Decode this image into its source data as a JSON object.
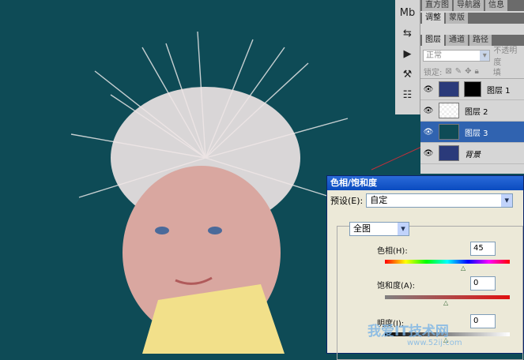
{
  "panel_tabs_top": [
    "直方图",
    "导航器",
    "信息"
  ],
  "panel_tabs_adjust": [
    "调整",
    "蒙版"
  ],
  "panel_tabs_layers": [
    "图层",
    "通道",
    "路径"
  ],
  "blend_mode": "正常",
  "opacity_label": "不透明度",
  "lock_label": "锁定:",
  "fill_label": "填",
  "layers": [
    {
      "name": "图层 1",
      "selected": false
    },
    {
      "name": "图层 2",
      "selected": false
    },
    {
      "name": "图层 3",
      "selected": true
    },
    {
      "name": "背景",
      "selected": false
    }
  ],
  "dialog": {
    "title": "色相/饱和度",
    "preset_label": "预设(E):",
    "preset_value": "自定",
    "channel_value": "全图",
    "hue_label": "色相(H):",
    "hue_value": "45",
    "saturation_label": "饱和度(A):",
    "saturation_value": "0",
    "lightness_label": "明度(I):",
    "lightness_value": "0"
  },
  "watermark": {
    "text": "我爱IT技术网",
    "url": "www.52ij.com"
  }
}
